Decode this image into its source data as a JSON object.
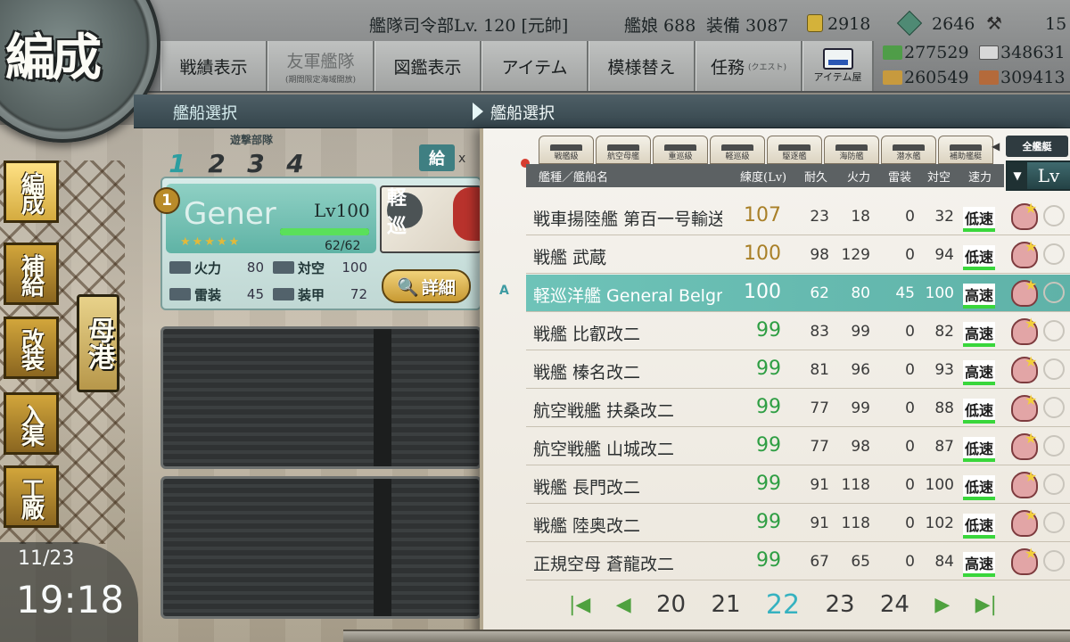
{
  "header": {
    "title": "編成",
    "hq_level": "艦隊司令部Lv. 120",
    "rank": "[元帥]",
    "ship_count": "艦娘 688",
    "equip_count": "装備 3087",
    "buckets": "2918",
    "dev_materials": "2646",
    "improvement_materials": "15"
  },
  "resources": {
    "fuel": "277529",
    "ammo": "348631",
    "steel": "260549",
    "bauxite": "309413"
  },
  "nav": [
    {
      "label": "戦績表示"
    },
    {
      "label": "友軍艦隊",
      "sub": "(期間限定海域開放)"
    },
    {
      "label": "図鑑表示"
    },
    {
      "label": "アイテム"
    },
    {
      "label": "模様替え"
    },
    {
      "label": "任務",
      "sub": "(クエスト)"
    },
    {
      "label": "アイテム屋"
    }
  ],
  "sections": {
    "left_title": "艦船選択",
    "right_title": "艦船選択"
  },
  "sidebar": {
    "items": [
      {
        "label": "編成",
        "active": true
      },
      {
        "label": "補給"
      },
      {
        "label": "改装"
      },
      {
        "label": "入渠"
      },
      {
        "label": "工廠"
      }
    ],
    "port": "母港"
  },
  "clock": {
    "date": "11/23",
    "time": "19:18"
  },
  "fleet": {
    "tabs": [
      "1",
      "2",
      "3",
      "4"
    ],
    "active_tab": 0,
    "escort_label": "遊撃部隊",
    "supply_label": "給",
    "supply_suffix": "x",
    "slot1": {
      "number": "1",
      "name": "Gener",
      "level": "Lv100",
      "hp": "62/62",
      "hp_fraction": 1.0,
      "stars": "★★★★★",
      "type_badge": "軽巡",
      "stats": [
        {
          "label": "火力",
          "value": "80"
        },
        {
          "label": "対空",
          "value": "100"
        },
        {
          "label": "雷装",
          "value": "45"
        },
        {
          "label": "装甲",
          "value": "72"
        }
      ],
      "detail_label": "詳細"
    }
  },
  "list": {
    "filter_tabs": [
      "戦艦級",
      "航空母艦",
      "重巡級",
      "軽巡級",
      "駆逐艦",
      "海防艦",
      "潜水艦",
      "補助艦艇"
    ],
    "all_label": "全艦艇",
    "sort_label": "Lv",
    "columns": [
      "艦種／艦船名",
      "練度(Lv)",
      "耐久",
      "火力",
      "雷装",
      "対空",
      "速力"
    ],
    "rows": [
      {
        "name": "戦車揚陸艦 第百一号輸送",
        "lv": "107",
        "hp": "23",
        "fp": "18",
        "tp": "0",
        "aa": "32",
        "speed": "低速",
        "lvcolor": "gold"
      },
      {
        "name": "戦艦 武蔵",
        "lv": "100",
        "hp": "98",
        "fp": "129",
        "tp": "0",
        "aa": "94",
        "speed": "低速",
        "lvcolor": "gold"
      },
      {
        "name": "軽巡洋艦 General Belgr",
        "lv": "100",
        "hp": "62",
        "fp": "80",
        "tp": "45",
        "aa": "100",
        "speed": "高速",
        "lvcolor": "gold",
        "selected": true
      },
      {
        "name": "戦艦 比叡改二",
        "lv": "99",
        "hp": "83",
        "fp": "99",
        "tp": "0",
        "aa": "82",
        "speed": "高速",
        "lvcolor": "green"
      },
      {
        "name": "戦艦 榛名改二",
        "lv": "99",
        "hp": "81",
        "fp": "96",
        "tp": "0",
        "aa": "93",
        "speed": "高速",
        "lvcolor": "green"
      },
      {
        "name": "航空戦艦 扶桑改二",
        "lv": "99",
        "hp": "77",
        "fp": "99",
        "tp": "0",
        "aa": "88",
        "speed": "低速",
        "lvcolor": "green"
      },
      {
        "name": "航空戦艦 山城改二",
        "lv": "99",
        "hp": "77",
        "fp": "98",
        "tp": "0",
        "aa": "87",
        "speed": "低速",
        "lvcolor": "green"
      },
      {
        "name": "戦艦 長門改二",
        "lv": "99",
        "hp": "91",
        "fp": "118",
        "tp": "0",
        "aa": "100",
        "speed": "低速",
        "lvcolor": "green"
      },
      {
        "name": "戦艦 陸奥改二",
        "lv": "99",
        "hp": "91",
        "fp": "118",
        "tp": "0",
        "aa": "102",
        "speed": "低速",
        "lvcolor": "green"
      },
      {
        "name": "正規空母 蒼龍改二",
        "lv": "99",
        "hp": "67",
        "fp": "65",
        "tp": "0",
        "aa": "84",
        "speed": "高速",
        "lvcolor": "green"
      }
    ],
    "selected_mark": "A",
    "pager": {
      "first": "|◀",
      "prev": "◀",
      "pages": [
        "20",
        "21",
        "22",
        "23",
        "24"
      ],
      "current": "22",
      "next": "▶",
      "last": "▶|"
    }
  },
  "colors": {
    "selected_row": "#6ec3b8",
    "level_gold": "#a98028",
    "level_green": "#2e9e43",
    "current_page": "#36b2c0"
  }
}
